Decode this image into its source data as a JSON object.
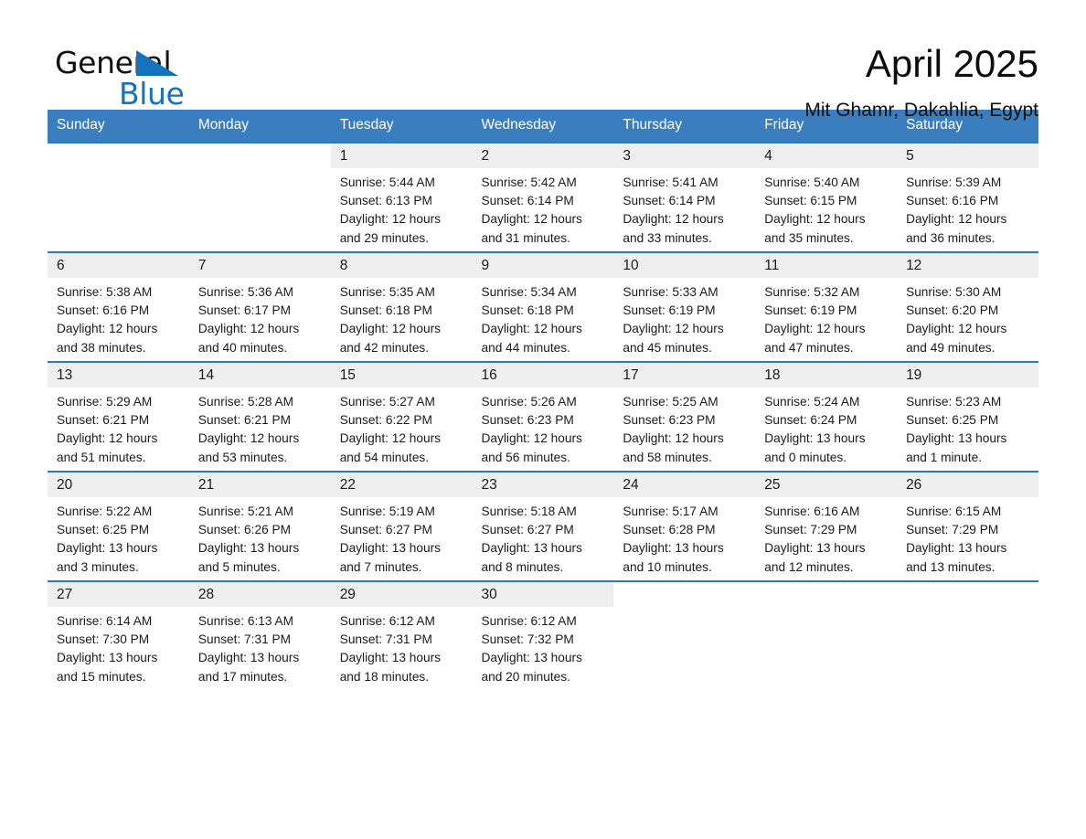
{
  "logo": {
    "word_one": "General",
    "word_two": "Blue",
    "triangle_color": "#1572bc"
  },
  "header": {
    "month_title": "April 2025",
    "location": "Mit Ghamr, Dakahlia, Egypt"
  },
  "theme": {
    "header_blue": "#3a7ebf",
    "row_rule_blue": "#2f78b8",
    "daynum_band": "#efeff0"
  },
  "calendar": {
    "weekday_headers": [
      "Sunday",
      "Monday",
      "Tuesday",
      "Wednesday",
      "Thursday",
      "Friday",
      "Saturday"
    ],
    "weeks": [
      [
        {
          "day": "",
          "text": "",
          "blank": true
        },
        {
          "day": "",
          "text": "",
          "blank": true
        },
        {
          "day": "1",
          "text": "Sunrise: 5:44 AM\nSunset: 6:13 PM\nDaylight: 12 hours\nand 29 minutes."
        },
        {
          "day": "2",
          "text": "Sunrise: 5:42 AM\nSunset: 6:14 PM\nDaylight: 12 hours\nand 31 minutes."
        },
        {
          "day": "3",
          "text": "Sunrise: 5:41 AM\nSunset: 6:14 PM\nDaylight: 12 hours\nand 33 minutes."
        },
        {
          "day": "4",
          "text": "Sunrise: 5:40 AM\nSunset: 6:15 PM\nDaylight: 12 hours\nand 35 minutes."
        },
        {
          "day": "5",
          "text": "Sunrise: 5:39 AM\nSunset: 6:16 PM\nDaylight: 12 hours\nand 36 minutes."
        }
      ],
      [
        {
          "day": "6",
          "text": "Sunrise: 5:38 AM\nSunset: 6:16 PM\nDaylight: 12 hours\nand 38 minutes."
        },
        {
          "day": "7",
          "text": "Sunrise: 5:36 AM\nSunset: 6:17 PM\nDaylight: 12 hours\nand 40 minutes."
        },
        {
          "day": "8",
          "text": "Sunrise: 5:35 AM\nSunset: 6:18 PM\nDaylight: 12 hours\nand 42 minutes."
        },
        {
          "day": "9",
          "text": "Sunrise: 5:34 AM\nSunset: 6:18 PM\nDaylight: 12 hours\nand 44 minutes."
        },
        {
          "day": "10",
          "text": "Sunrise: 5:33 AM\nSunset: 6:19 PM\nDaylight: 12 hours\nand 45 minutes."
        },
        {
          "day": "11",
          "text": "Sunrise: 5:32 AM\nSunset: 6:19 PM\nDaylight: 12 hours\nand 47 minutes."
        },
        {
          "day": "12",
          "text": "Sunrise: 5:30 AM\nSunset: 6:20 PM\nDaylight: 12 hours\nand 49 minutes."
        }
      ],
      [
        {
          "day": "13",
          "text": "Sunrise: 5:29 AM\nSunset: 6:21 PM\nDaylight: 12 hours\nand 51 minutes."
        },
        {
          "day": "14",
          "text": "Sunrise: 5:28 AM\nSunset: 6:21 PM\nDaylight: 12 hours\nand 53 minutes."
        },
        {
          "day": "15",
          "text": "Sunrise: 5:27 AM\nSunset: 6:22 PM\nDaylight: 12 hours\nand 54 minutes."
        },
        {
          "day": "16",
          "text": "Sunrise: 5:26 AM\nSunset: 6:23 PM\nDaylight: 12 hours\nand 56 minutes."
        },
        {
          "day": "17",
          "text": "Sunrise: 5:25 AM\nSunset: 6:23 PM\nDaylight: 12 hours\nand 58 minutes."
        },
        {
          "day": "18",
          "text": "Sunrise: 5:24 AM\nSunset: 6:24 PM\nDaylight: 13 hours\nand 0 minutes."
        },
        {
          "day": "19",
          "text": "Sunrise: 5:23 AM\nSunset: 6:25 PM\nDaylight: 13 hours\nand 1 minute."
        }
      ],
      [
        {
          "day": "20",
          "text": "Sunrise: 5:22 AM\nSunset: 6:25 PM\nDaylight: 13 hours\nand 3 minutes."
        },
        {
          "day": "21",
          "text": "Sunrise: 5:21 AM\nSunset: 6:26 PM\nDaylight: 13 hours\nand 5 minutes."
        },
        {
          "day": "22",
          "text": "Sunrise: 5:19 AM\nSunset: 6:27 PM\nDaylight: 13 hours\nand 7 minutes."
        },
        {
          "day": "23",
          "text": "Sunrise: 5:18 AM\nSunset: 6:27 PM\nDaylight: 13 hours\nand 8 minutes."
        },
        {
          "day": "24",
          "text": "Sunrise: 5:17 AM\nSunset: 6:28 PM\nDaylight: 13 hours\nand 10 minutes."
        },
        {
          "day": "25",
          "text": "Sunrise: 6:16 AM\nSunset: 7:29 PM\nDaylight: 13 hours\nand 12 minutes."
        },
        {
          "day": "26",
          "text": "Sunrise: 6:15 AM\nSunset: 7:29 PM\nDaylight: 13 hours\nand 13 minutes."
        }
      ],
      [
        {
          "day": "27",
          "text": "Sunrise: 6:14 AM\nSunset: 7:30 PM\nDaylight: 13 hours\nand 15 minutes."
        },
        {
          "day": "28",
          "text": "Sunrise: 6:13 AM\nSunset: 7:31 PM\nDaylight: 13 hours\nand 17 minutes."
        },
        {
          "day": "29",
          "text": "Sunrise: 6:12 AM\nSunset: 7:31 PM\nDaylight: 13 hours\nand 18 minutes."
        },
        {
          "day": "30",
          "text": "Sunrise: 6:12 AM\nSunset: 7:32 PM\nDaylight: 13 hours\nand 20 minutes."
        },
        {
          "day": "",
          "text": "",
          "blank": true
        },
        {
          "day": "",
          "text": "",
          "blank": true
        },
        {
          "day": "",
          "text": "",
          "blank": true
        }
      ]
    ]
  }
}
